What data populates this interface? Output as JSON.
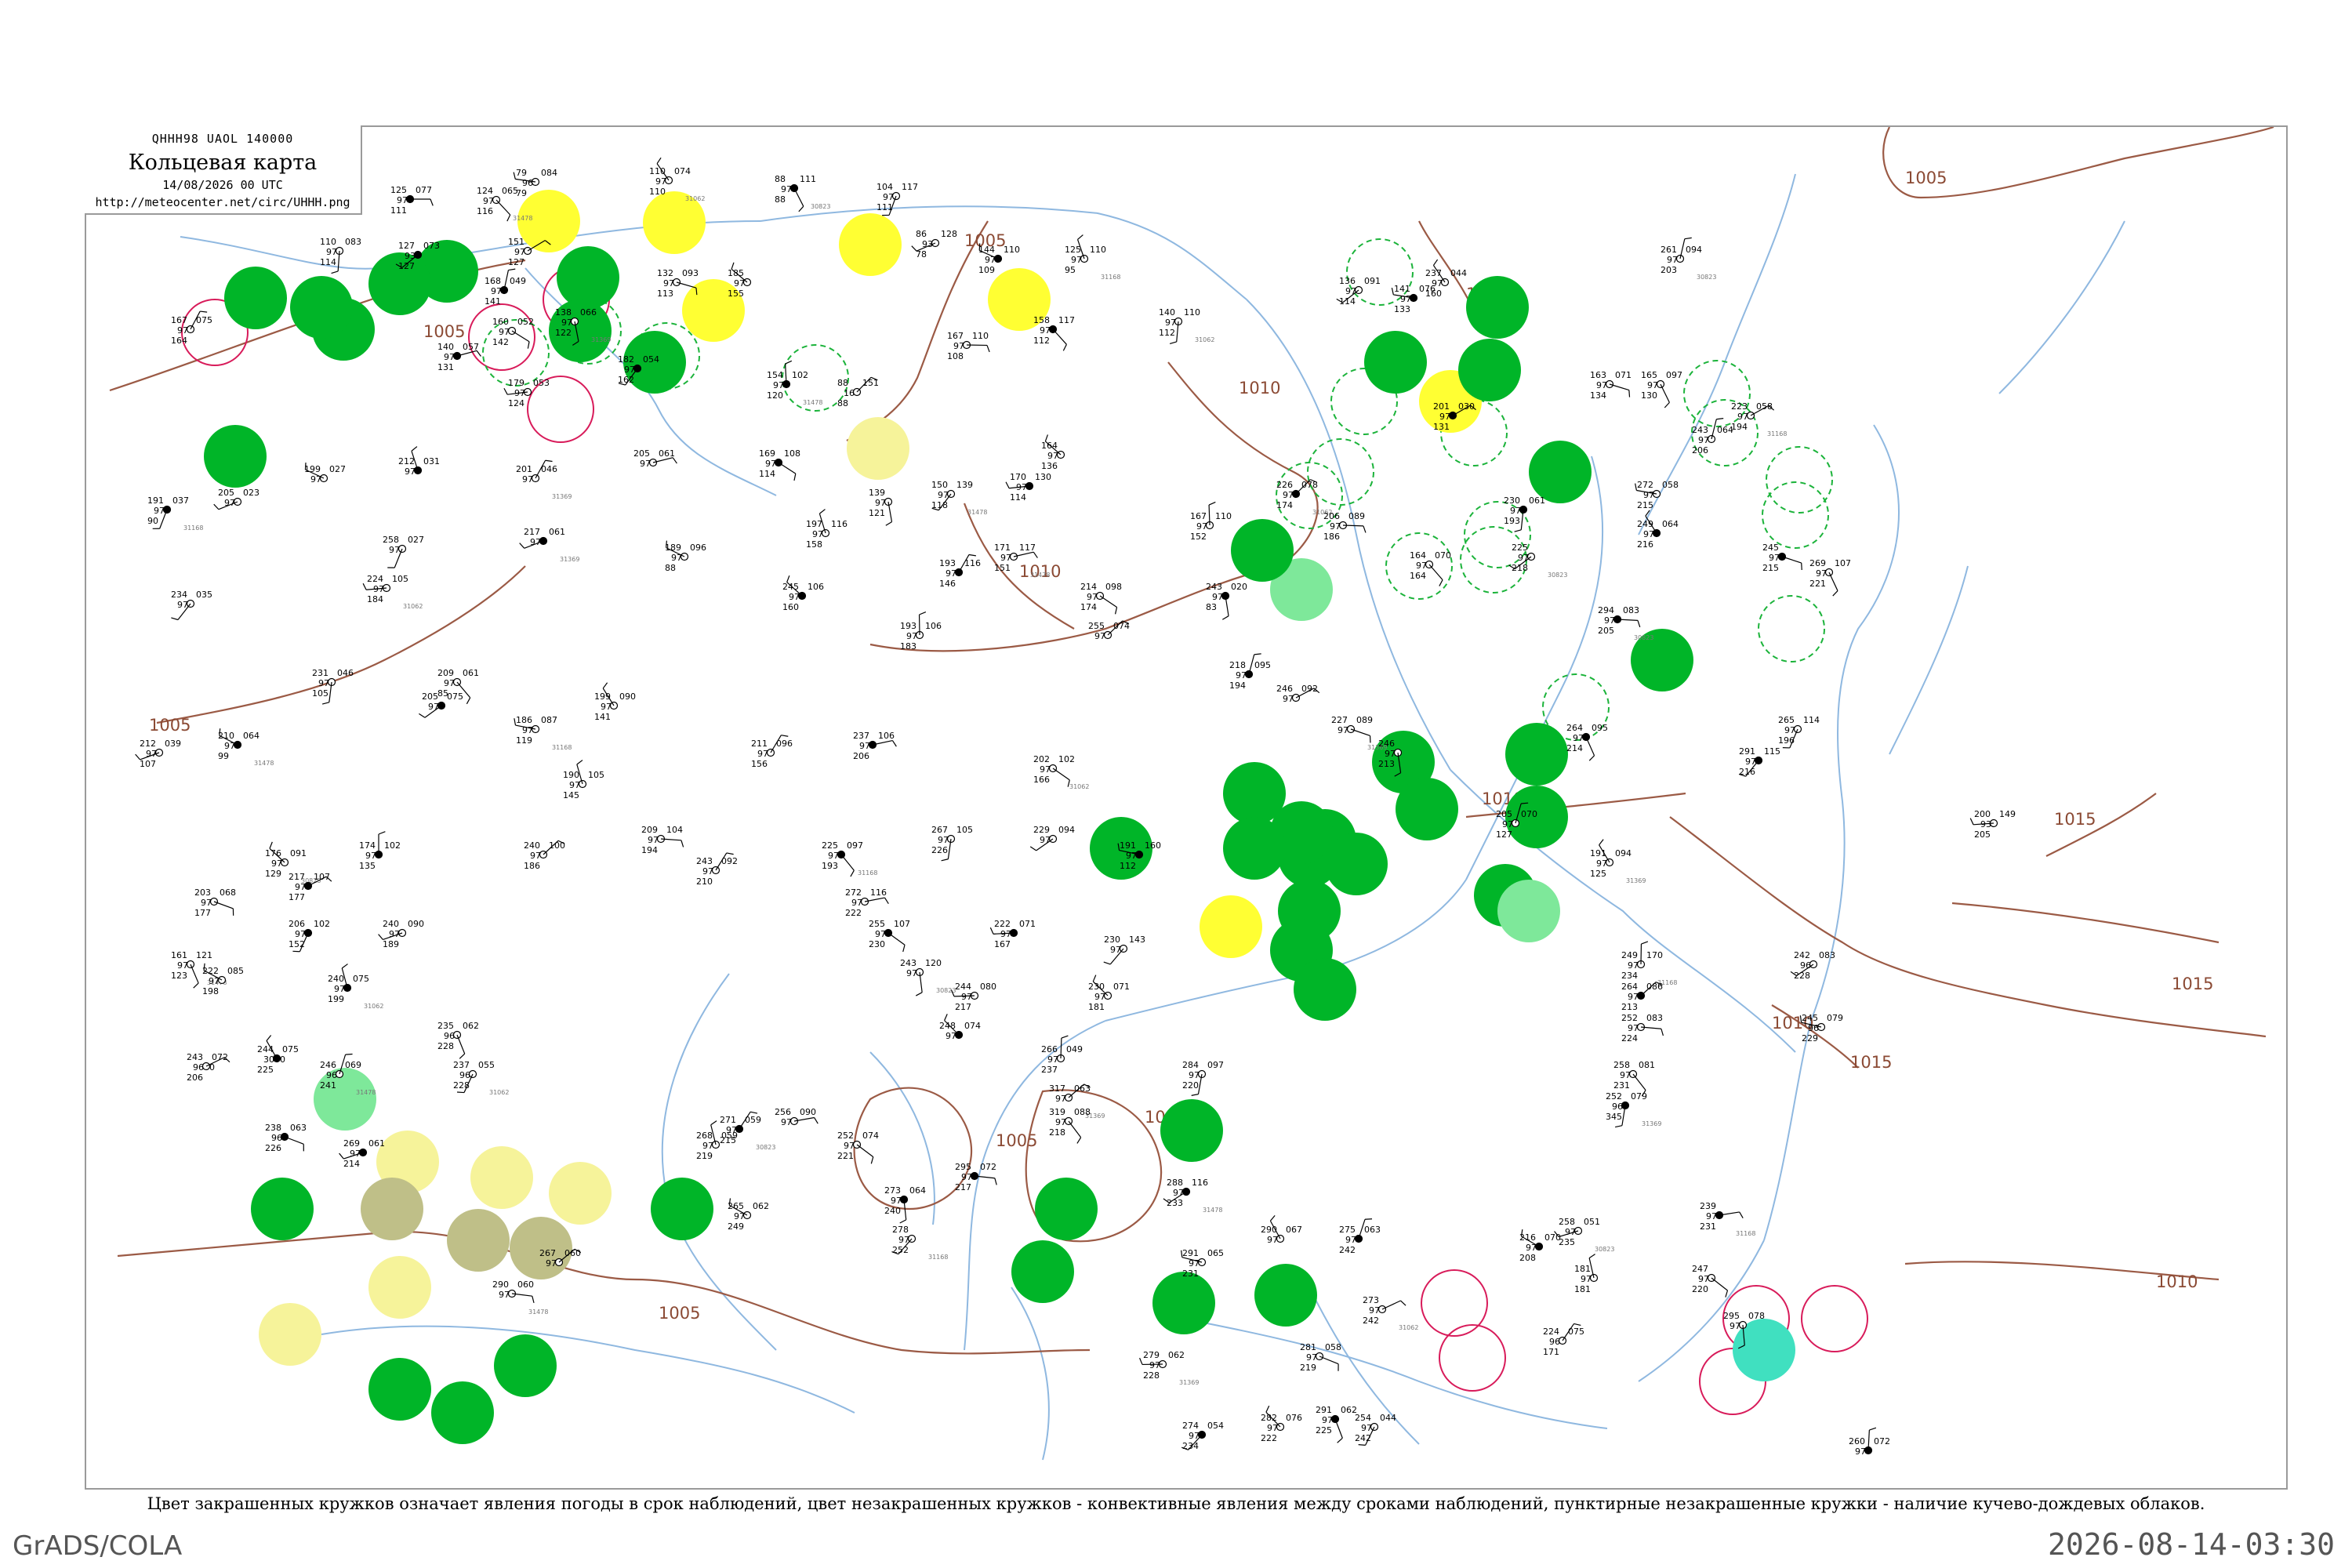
{
  "header": {
    "code": "QHHH98  UAOL  140000",
    "title": "Кольцевая карта",
    "datetime": "14/08/2026 00 UTC",
    "url": "http://meteocenter.net/circ/UHHH.png"
  },
  "caption": "Цвет закрашенных кружков означает явления погоды в срок наблюдений, цвет незакрашенных кружков - конвективные явления между сроками наблюдений, пунктирные незакрашенные кружки - наличие кучево-дождевых облаков.",
  "footer": {
    "left": "GrADS/COLA",
    "right": "2026-08-14-03:30"
  },
  "colors": {
    "isobar": "#9b5a45",
    "river": "#8fb8e0",
    "rain": "#00b528",
    "shower": "#00d010",
    "drizzle": "#7ee89a",
    "fog": "#ffff33",
    "haze": "#f6f39a",
    "dust": "#bfbf88",
    "cyan": "#40e0c0",
    "cb_dashed": "#1bb33a",
    "thunder_open": "#d81b5a"
  },
  "isobars": [
    {
      "label": "1005"
    },
    {
      "label": "1005"
    },
    {
      "label": "1005"
    },
    {
      "label": "1005"
    },
    {
      "label": "1005"
    },
    {
      "label": "1005"
    },
    {
      "label": "1010"
    },
    {
      "label": "1010"
    },
    {
      "label": "1010"
    },
    {
      "label": "1010"
    },
    {
      "label": "1010"
    },
    {
      "label": "1010"
    },
    {
      "label": "1015"
    },
    {
      "label": "1015"
    },
    {
      "label": "1015"
    },
    {
      "label": "1005"
    }
  ],
  "stations": [
    {
      "t": "125",
      "p": "077",
      "d": "97",
      "w": "111"
    },
    {
      "t": "124",
      "p": "065",
      "d": "97",
      "w": "116"
    },
    {
      "t": "110",
      "p": "083",
      "d": "97",
      "w": "114"
    },
    {
      "t": "127",
      "p": "073",
      "d": "93",
      "w": "127"
    },
    {
      "t": "79",
      "p": "084",
      "d": "96",
      "w": "79"
    },
    {
      "t": "110",
      "p": "074",
      "d": "97",
      "w": "110"
    },
    {
      "t": "168",
      "p": "049",
      "d": "97",
      "w": "141"
    },
    {
      "t": "151",
      "p": "",
      "d": "97",
      "w": "127"
    },
    {
      "t": "132",
      "p": "093",
      "d": "97",
      "w": "113"
    },
    {
      "t": "88",
      "p": "111",
      "d": "97",
      "w": "88"
    },
    {
      "t": "104",
      "p": "117",
      "d": "97",
      "w": "111"
    },
    {
      "t": "86",
      "p": "128",
      "d": "93",
      "w": "78"
    },
    {
      "t": "144",
      "p": "110",
      "d": "97",
      "w": "109"
    },
    {
      "t": "125",
      "p": "110",
      "d": "97",
      "w": "95"
    },
    {
      "t": "167",
      "p": "075",
      "d": "97",
      "w": "164"
    },
    {
      "t": "140",
      "p": "057",
      "d": "97",
      "w": "131"
    },
    {
      "t": "160",
      "p": "052",
      "d": "97",
      "w": "142"
    },
    {
      "t": "138",
      "p": "066",
      "d": "97",
      "w": "122"
    },
    {
      "t": "182",
      "p": "054",
      "d": "97",
      "w": "162"
    },
    {
      "t": "179",
      "p": "053",
      "d": "97",
      "w": "124"
    },
    {
      "t": "185",
      "p": "",
      "d": "97",
      "w": "155"
    },
    {
      "t": "154",
      "p": "102",
      "d": "97",
      "w": "120"
    },
    {
      "t": "88",
      "p": "151",
      "d": "16",
      "w": "88"
    },
    {
      "t": "167",
      "p": "110",
      "d": "97",
      "w": "108"
    },
    {
      "t": "158",
      "p": "117",
      "d": "97",
      "w": "112"
    },
    {
      "t": "140",
      "p": "110",
      "d": "97",
      "w": "112"
    },
    {
      "t": "136",
      "p": "091",
      "d": "97",
      "w": "114"
    },
    {
      "t": "141",
      "p": "076",
      "d": "97",
      "w": "133"
    },
    {
      "t": "237",
      "p": "044",
      "d": "97",
      "w": "160"
    },
    {
      "t": "261",
      "p": "094",
      "d": "97",
      "w": "203"
    },
    {
      "t": "201",
      "p": "030",
      "d": "97",
      "w": "131"
    },
    {
      "t": "163",
      "p": "071",
      "d": "97",
      "w": "134"
    },
    {
      "t": "165",
      "p": "097",
      "d": "97",
      "w": "130"
    },
    {
      "t": "191",
      "p": "037",
      "d": "97",
      "w": "90"
    },
    {
      "t": "205",
      "p": "023",
      "d": "97",
      "w": ""
    },
    {
      "t": "199",
      "p": "027",
      "d": "97",
      "w": ""
    },
    {
      "t": "212",
      "p": "031",
      "d": "97",
      "w": ""
    },
    {
      "t": "201",
      "p": "046",
      "d": "97",
      "w": ""
    },
    {
      "t": "205",
      "p": "061",
      "d": "97",
      "w": ""
    },
    {
      "t": "169",
      "p": "108",
      "d": "97",
      "w": "114"
    },
    {
      "t": "139",
      "p": "",
      "d": "97",
      "w": "121"
    },
    {
      "t": "150",
      "p": "139",
      "d": "97",
      "w": "118"
    },
    {
      "t": "170",
      "p": "130",
      "d": "97",
      "w": "114"
    },
    {
      "t": "164",
      "p": "",
      "d": "97",
      "w": "136"
    },
    {
      "t": "167",
      "p": "110",
      "d": "97",
      "w": "152"
    },
    {
      "t": "226",
      "p": "078",
      "d": "97",
      "w": "174"
    },
    {
      "t": "206",
      "p": "089",
      "d": "97",
      "w": "186"
    },
    {
      "t": "164",
      "p": "070",
      "d": "97",
      "w": "164"
    },
    {
      "t": "230",
      "p": "061",
      "d": "97",
      "w": "193"
    },
    {
      "t": "225",
      "p": "",
      "d": "97",
      "w": "218"
    },
    {
      "t": "272",
      "p": "058",
      "d": "97",
      "w": "215"
    },
    {
      "t": "249",
      "p": "064",
      "d": "97",
      "w": "216"
    },
    {
      "t": "243",
      "p": "064",
      "d": "97",
      "w": "206"
    },
    {
      "t": "223",
      "p": "058",
      "d": "97",
      "w": "194"
    },
    {
      "t": "245",
      "p": "",
      "d": "97",
      "w": "215"
    },
    {
      "t": "269",
      "p": "107",
      "d": "97",
      "w": "221"
    },
    {
      "t": "258",
      "p": "027",
      "d": "97",
      "w": ""
    },
    {
      "t": "217",
      "p": "061",
      "d": "97",
      "w": ""
    },
    {
      "t": "189",
      "p": "096",
      "d": "97",
      "w": "88"
    },
    {
      "t": "197",
      "p": "116",
      "d": "97",
      "w": "158"
    },
    {
      "t": "193",
      "p": "116",
      "d": "97",
      "w": "146"
    },
    {
      "t": "171",
      "p": "117",
      "d": "97",
      "w": "151"
    },
    {
      "t": "214",
      "p": "098",
      "d": "97",
      "w": "174"
    },
    {
      "t": "243",
      "p": "020",
      "d": "97",
      "w": "83"
    },
    {
      "t": "234",
      "p": "035",
      "d": "97",
      "w": ""
    },
    {
      "t": "224",
      "p": "105",
      "d": "97",
      "w": "184"
    },
    {
      "t": "245",
      "p": "106",
      "d": "97",
      "w": "160"
    },
    {
      "t": "193",
      "p": "106",
      "d": "97",
      "w": "183"
    },
    {
      "t": "255",
      "p": "074",
      "d": "97",
      "w": ""
    },
    {
      "t": "294",
      "p": "083",
      "d": "97",
      "w": "205"
    },
    {
      "t": "209",
      "p": "061",
      "d": "97",
      "w": "85"
    },
    {
      "t": "231",
      "p": "046",
      "d": "97",
      "w": "105"
    },
    {
      "t": "205",
      "p": "075",
      "d": "97",
      "w": ""
    },
    {
      "t": "186",
      "p": "087",
      "d": "97",
      "w": "119"
    },
    {
      "t": "199",
      "p": "090",
      "d": "97",
      "w": "141"
    },
    {
      "t": "218",
      "p": "095",
      "d": "97",
      "w": "194"
    },
    {
      "t": "246",
      "p": "092",
      "d": "97",
      "w": ""
    },
    {
      "t": "227",
      "p": "089",
      "d": "97",
      "w": ""
    },
    {
      "t": "264",
      "p": "095",
      "d": "97",
      "w": "214"
    },
    {
      "t": "265",
      "p": "114",
      "d": "97",
      "w": "196"
    },
    {
      "t": "212",
      "p": "039",
      "d": "97",
      "w": "107"
    },
    {
      "t": "210",
      "p": "064",
      "d": "97",
      "w": "99"
    },
    {
      "t": "190",
      "p": "105",
      "d": "97",
      "w": "145"
    },
    {
      "t": "211",
      "p": "096",
      "d": "97",
      "w": "156"
    },
    {
      "t": "237",
      "p": "106",
      "d": "97",
      "w": "206"
    },
    {
      "t": "202",
      "p": "102",
      "d": "97",
      "w": "166"
    },
    {
      "t": "246",
      "p": "",
      "d": "97",
      "w": "213"
    },
    {
      "t": "291",
      "p": "115",
      "d": "97",
      "w": "216"
    },
    {
      "t": "200",
      "p": "149",
      "d": "93",
      "w": "205"
    },
    {
      "t": "176",
      "p": "091",
      "d": "97",
      "w": "129"
    },
    {
      "t": "174",
      "p": "102",
      "d": "97",
      "w": "135"
    },
    {
      "t": "240",
      "p": "100",
      "d": "97",
      "w": "186"
    },
    {
      "t": "209",
      "p": "104",
      "d": "97",
      "w": "194"
    },
    {
      "t": "225",
      "p": "097",
      "d": "97",
      "w": "193"
    },
    {
      "t": "267",
      "p": "105",
      "d": "97",
      "w": "226"
    },
    {
      "t": "229",
      "p": "094",
      "d": "97",
      "w": ""
    },
    {
      "t": "191",
      "p": "160",
      "d": "97",
      "w": "112"
    },
    {
      "t": "191",
      "p": "094",
      "d": "97",
      "w": "125"
    },
    {
      "t": "205",
      "p": "070",
      "d": "97",
      "w": "127"
    },
    {
      "t": "217",
      "p": "107",
      "d": "97",
      "w": "177"
    },
    {
      "t": "203",
      "p": "068",
      "d": "97",
      "w": "177"
    },
    {
      "t": "161",
      "p": "121",
      "d": "97",
      "w": "123"
    },
    {
      "t": "206",
      "p": "102",
      "d": "97",
      "w": "152"
    },
    {
      "t": "240",
      "p": "090",
      "d": "97",
      "w": "189"
    },
    {
      "t": "222",
      "p": "085",
      "d": "97",
      "w": "198"
    },
    {
      "t": "240",
      "p": "075",
      "d": "97",
      "w": "199"
    },
    {
      "t": "243",
      "p": "092",
      "d": "97",
      "w": "210"
    },
    {
      "t": "272",
      "p": "116",
      "d": "97",
      "w": "222"
    },
    {
      "t": "255",
      "p": "107",
      "d": "97",
      "w": "230"
    },
    {
      "t": "243",
      "p": "120",
      "d": "97",
      "w": ""
    },
    {
      "t": "230",
      "p": "143",
      "d": "97",
      "w": ""
    },
    {
      "t": "222",
      "p": "071",
      "d": "97",
      "w": "167"
    },
    {
      "t": "230",
      "p": "071",
      "d": "97",
      "w": "181"
    },
    {
      "t": "249",
      "p": "170",
      "d": "97",
      "w": "234"
    },
    {
      "t": "264",
      "p": "086",
      "d": "97",
      "w": "213"
    },
    {
      "t": "252",
      "p": "083",
      "d": "97",
      "w": "224"
    },
    {
      "t": "258",
      "p": "081",
      "d": "97",
      "w": "231"
    },
    {
      "t": "252",
      "p": "079",
      "d": "96",
      "w": "345"
    },
    {
      "t": "242",
      "p": "083",
      "d": "96",
      "w": "228"
    },
    {
      "t": "245",
      "p": "079",
      "d": "96",
      "w": "229"
    },
    {
      "t": "244",
      "p": "075",
      "d": "3000",
      "w": "225"
    },
    {
      "t": "246",
      "p": "069",
      "d": "96",
      "w": "241"
    },
    {
      "t": "243",
      "p": "072",
      "d": "9600",
      "w": "206"
    },
    {
      "t": "238",
      "p": "063",
      "d": "96",
      "w": "226"
    },
    {
      "t": "235",
      "p": "062",
      "d": "96",
      "w": "228"
    },
    {
      "t": "237",
      "p": "055",
      "d": "96",
      "w": "228"
    },
    {
      "t": "269",
      "p": "061",
      "d": "97",
      "w": "214"
    },
    {
      "t": "265",
      "p": "062",
      "d": "97",
      "w": "249"
    },
    {
      "t": "268",
      "p": "059",
      "d": "97",
      "w": "219"
    },
    {
      "t": "271",
      "p": "059",
      "d": "97",
      "w": "215"
    },
    {
      "t": "256",
      "p": "090",
      "d": "97",
      "w": ""
    },
    {
      "t": "252",
      "p": "074",
      "d": "97",
      "w": "221"
    },
    {
      "t": "273",
      "p": "064",
      "d": "97",
      "w": "240"
    },
    {
      "t": "278",
      "p": "",
      "d": "97",
      "w": "252"
    },
    {
      "t": "244",
      "p": "080",
      "d": "97",
      "w": "217"
    },
    {
      "t": "248",
      "p": "074",
      "d": "97",
      "w": ""
    },
    {
      "t": "266",
      "p": "049",
      "d": "97",
      "w": "237"
    },
    {
      "t": "317",
      "p": "063",
      "d": "97",
      "w": ""
    },
    {
      "t": "295",
      "p": "072",
      "d": "97",
      "w": "217"
    },
    {
      "t": "319",
      "p": "088",
      "d": "97",
      "w": "218"
    },
    {
      "t": "284",
      "p": "097",
      "d": "97",
      "w": "220"
    },
    {
      "t": "288",
      "p": "116",
      "d": "97",
      "w": "233"
    },
    {
      "t": "291",
      "p": "065",
      "d": "97",
      "w": "231"
    },
    {
      "t": "290",
      "p": "067",
      "d": "97",
      "w": ""
    },
    {
      "t": "275",
      "p": "063",
      "d": "97",
      "w": "242"
    },
    {
      "t": "273",
      "p": "",
      "d": "97",
      "w": "242"
    },
    {
      "t": "281",
      "p": "058",
      "d": "97",
      "w": "219"
    },
    {
      "t": "291",
      "p": "062",
      "d": "97",
      "w": "225"
    },
    {
      "t": "254",
      "p": "044",
      "d": "97",
      "w": "242"
    },
    {
      "t": "258",
      "p": "051",
      "d": "97",
      "w": "235"
    },
    {
      "t": "216",
      "p": "070",
      "d": "97",
      "w": "208"
    },
    {
      "t": "181",
      "p": "",
      "d": "97",
      "w": "181"
    },
    {
      "t": "224",
      "p": "075",
      "d": "96",
      "w": "171"
    },
    {
      "t": "239",
      "p": "",
      "d": "97",
      "w": "231"
    },
    {
      "t": "247",
      "p": "",
      "d": "97",
      "w": "220"
    },
    {
      "t": "295",
      "p": "078",
      "d": "97",
      "w": ""
    },
    {
      "t": "274",
      "p": "054",
      "d": "97",
      "w": "234"
    },
    {
      "t": "279",
      "p": "062",
      "d": "97",
      "w": "228"
    },
    {
      "t": "282",
      "p": "076",
      "d": "97",
      "w": "222"
    },
    {
      "t": "260",
      "p": "072",
      "d": "97",
      "w": ""
    },
    {
      "t": "267",
      "p": "060",
      "d": "97",
      "w": ""
    },
    {
      "t": "290",
      "p": "060",
      "d": "97",
      "w": ""
    }
  ],
  "colored_stations": [
    {
      "kind": "rain"
    },
    {
      "kind": "rain"
    },
    {
      "kind": "rain"
    },
    {
      "kind": "rain"
    },
    {
      "kind": "fog"
    },
    {
      "kind": "fog"
    },
    {
      "kind": "fog"
    },
    {
      "kind": "fog"
    },
    {
      "kind": "fog"
    },
    {
      "kind": "fog"
    },
    {
      "kind": "haze"
    },
    {
      "kind": "rain"
    },
    {
      "kind": "rain"
    },
    {
      "kind": "rain"
    },
    {
      "kind": "rain"
    },
    {
      "kind": "rain"
    },
    {
      "kind": "rain"
    },
    {
      "kind": "rain"
    },
    {
      "kind": "rain"
    },
    {
      "kind": "rain"
    },
    {
      "kind": "rain"
    },
    {
      "kind": "rain"
    },
    {
      "kind": "rain"
    },
    {
      "kind": "rain"
    },
    {
      "kind": "drizzle"
    },
    {
      "kind": "drizzle"
    },
    {
      "kind": "rain"
    },
    {
      "kind": "rain"
    },
    {
      "kind": "rain"
    },
    {
      "kind": "rain"
    },
    {
      "kind": "rain"
    },
    {
      "kind": "rain"
    },
    {
      "kind": "rain"
    },
    {
      "kind": "rain"
    },
    {
      "kind": "rain"
    },
    {
      "kind": "fog"
    },
    {
      "kind": "rain"
    },
    {
      "kind": "rain"
    },
    {
      "kind": "rain"
    },
    {
      "kind": "rain"
    },
    {
      "kind": "rain"
    },
    {
      "kind": "rain"
    },
    {
      "kind": "rain"
    },
    {
      "kind": "rain"
    },
    {
      "kind": "rain"
    },
    {
      "kind": "drizzle"
    },
    {
      "kind": "rain"
    },
    {
      "kind": "haze"
    },
    {
      "kind": "haze"
    },
    {
      "kind": "dust"
    },
    {
      "kind": "haze"
    },
    {
      "kind": "dust"
    },
    {
      "kind": "dust"
    },
    {
      "kind": "haze"
    },
    {
      "kind": "haze"
    },
    {
      "kind": "rain"
    },
    {
      "kind": "rain"
    },
    {
      "kind": "rain"
    },
    {
      "kind": "rain"
    },
    {
      "kind": "cyan"
    }
  ],
  "open_circles": [
    {
      "kind": "thunder_open"
    },
    {
      "kind": "thunder_open"
    },
    {
      "kind": "thunder_open"
    },
    {
      "kind": "thunder_open"
    },
    {
      "kind": "thunder_open"
    },
    {
      "kind": "thunder_open"
    },
    {
      "kind": "thunder_open"
    },
    {
      "kind": "thunder_open"
    },
    {
      "kind": "thunder_open"
    },
    {
      "kind": "cb_dashed"
    },
    {
      "kind": "cb_dashed"
    },
    {
      "kind": "cb_dashed"
    },
    {
      "kind": "cb_dashed"
    },
    {
      "kind": "cb_dashed"
    },
    {
      "kind": "cb_dashed"
    },
    {
      "kind": "cb_dashed"
    },
    {
      "kind": "cb_dashed"
    },
    {
      "kind": "cb_dashed"
    },
    {
      "kind": "cb_dashed"
    },
    {
      "kind": "cb_dashed"
    },
    {
      "kind": "cb_dashed"
    },
    {
      "kind": "cb_dashed"
    },
    {
      "kind": "cb_dashed"
    },
    {
      "kind": "cb_dashed"
    },
    {
      "kind": "cb_dashed"
    },
    {
      "kind": "cb_dashed"
    },
    {
      "kind": "cb_dashed"
    }
  ]
}
